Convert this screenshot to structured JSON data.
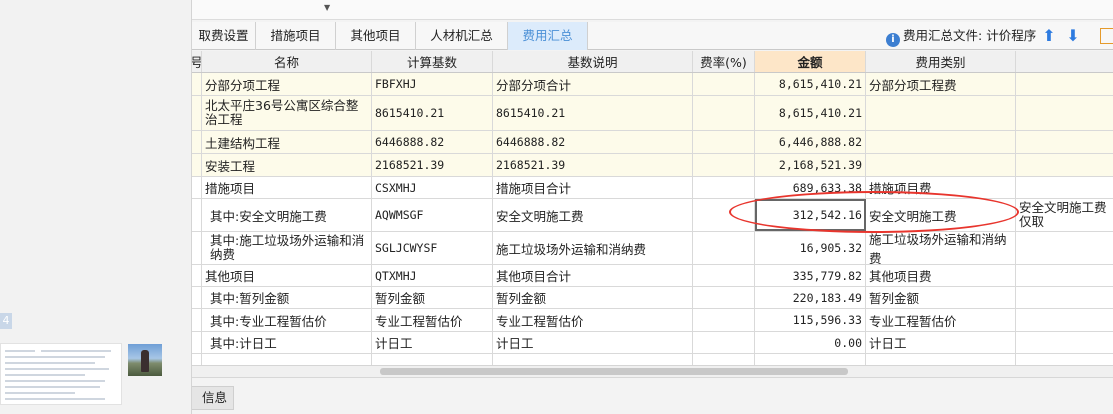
{
  "left_panel": {
    "page_number": "4"
  },
  "tabs": [
    {
      "label": "取费设置"
    },
    {
      "label": "措施项目"
    },
    {
      "label": "其他项目"
    },
    {
      "label": "人材机汇总"
    },
    {
      "label": "费用汇总"
    }
  ],
  "active_tab": "费用汇总",
  "summary_file": {
    "label": "费用汇总文件:",
    "value": "计价程序"
  },
  "table": {
    "headers": {
      "code": "号",
      "name": "名称",
      "base": "计算基数",
      "desc": "基数说明",
      "rate": "费率(%)",
      "amount": "金额",
      "type": "费用类别"
    },
    "rows": [
      {
        "name": "分部分项工程",
        "base": "FBFXHJ",
        "desc": "分部分项合计",
        "rate": "",
        "amount": "8,615,410.21",
        "type": "分部分项工程费",
        "extra": ""
      },
      {
        "name": "北太平庄36号公寓区综合整治工程",
        "base": "8615410.21",
        "desc": "8615410.21",
        "rate": "",
        "amount": "8,615,410.21",
        "type": "",
        "extra": ""
      },
      {
        "name": "土建结构工程",
        "base": "6446888.82",
        "desc": "6446888.82",
        "rate": "",
        "amount": "6,446,888.82",
        "type": "",
        "extra": ""
      },
      {
        "name": "安装工程",
        "base": "2168521.39",
        "desc": "2168521.39",
        "rate": "",
        "amount": "2,168,521.39",
        "type": "",
        "extra": ""
      },
      {
        "name": "措施项目",
        "base": "CSXMHJ",
        "desc": "措施项目合计",
        "rate": "",
        "amount": "689,633.38",
        "type": "措施项目费",
        "extra": ""
      },
      {
        "name": "其中:安全文明施工费",
        "base": "AQWMSGF",
        "desc": "安全文明施工费",
        "rate": "",
        "amount": "312,542.16",
        "type": "安全文明施工费",
        "extra": "安全文明施工费仅取"
      },
      {
        "name": "其中:施工垃圾场外运输和消纳费",
        "base": "SGLJCWYSF",
        "desc": "施工垃圾场外运输和消纳费",
        "rate": "",
        "amount": "16,905.32",
        "type": "施工垃圾场外运输和消纳费",
        "extra": ""
      },
      {
        "name": "其他项目",
        "base": "QTXMHJ",
        "desc": "其他项目合计",
        "rate": "",
        "amount": "335,779.82",
        "type": "其他项目费",
        "extra": ""
      },
      {
        "name": "其中:暂列金额",
        "base": "暂列金额",
        "desc": "暂列金额",
        "rate": "",
        "amount": "220,183.49",
        "type": "暂列金额",
        "extra": ""
      },
      {
        "name": "其中:专业工程暂估价",
        "base": "专业工程暂估价",
        "desc": "专业工程暂估价",
        "rate": "",
        "amount": "115,596.33",
        "type": "专业工程暂估价",
        "extra": ""
      },
      {
        "name": "其中:计日工",
        "base": "计日工",
        "desc": "计日工",
        "rate": "",
        "amount": "0.00",
        "type": "计日工",
        "extra": ""
      }
    ]
  },
  "bottom_tab": {
    "label": "信息"
  },
  "highlight_color": "#e8352d",
  "accent_color": "#4a8fd6"
}
